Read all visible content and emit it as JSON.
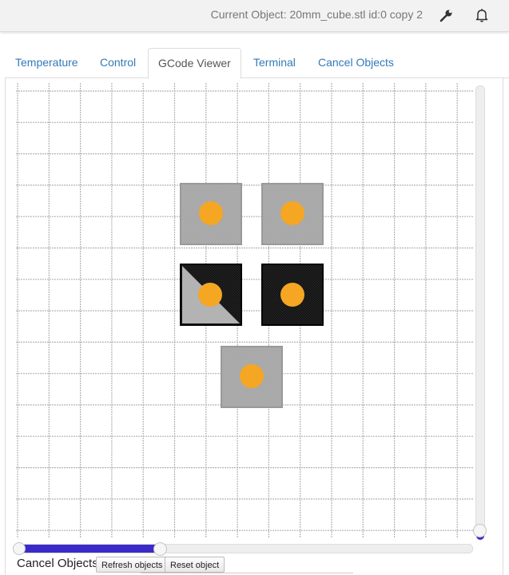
{
  "header": {
    "current_object": "Current Object: 20mm_cube.stl id:0 copy 2",
    "icons": [
      "wrench-icon",
      "bell-icon"
    ]
  },
  "tabs": [
    {
      "label": "Temperature",
      "active": false
    },
    {
      "label": "Control",
      "active": false
    },
    {
      "label": "GCode Viewer",
      "active": true
    },
    {
      "label": "Terminal",
      "active": false
    },
    {
      "label": "Cancel Objects",
      "active": false
    }
  ],
  "viewer": {
    "grid_color": "#b4b4b4",
    "marker_color": "#f5a623",
    "objects": [
      {
        "id": 1,
        "state": "pending"
      },
      {
        "id": 2,
        "state": "pending"
      },
      {
        "id": 3,
        "state": "in-progress"
      },
      {
        "id": 4,
        "state": "done"
      },
      {
        "id": 5,
        "state": "pending"
      }
    ],
    "slider_color": "#3a2bc8"
  },
  "cancel_objects": {
    "label": "Cancel Objects",
    "refresh_label": "Refresh objects",
    "reset_label": "Reset object"
  }
}
